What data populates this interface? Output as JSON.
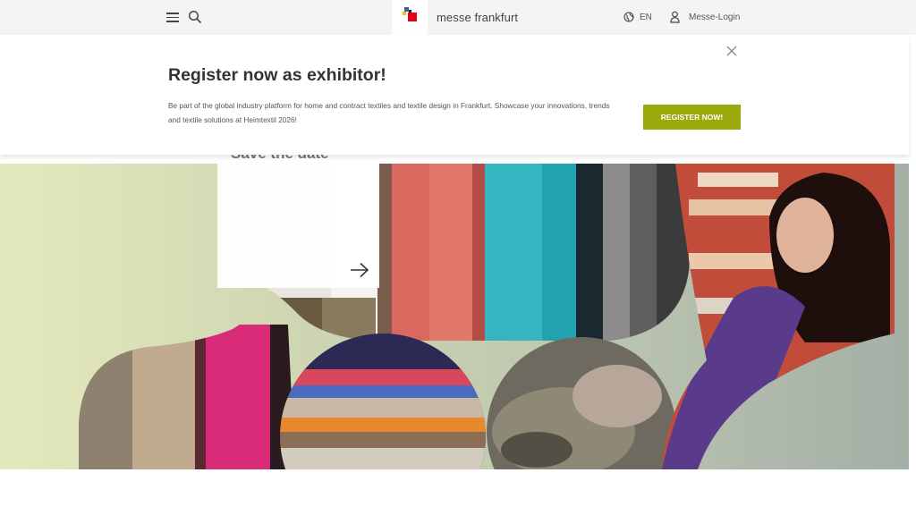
{
  "header": {
    "brand": "messe frankfurt",
    "language": "EN",
    "login_label": "Messe-Login"
  },
  "banner": {
    "title": "Register now as exhibitor!",
    "text": "Be part of the global industry platform for home and contract textiles and textile design in Frankfurt. Showcase your innovations, trends and textile solutions at Heimtextil 2026!",
    "cta_label": "REGISTER NOW!"
  },
  "hero": {
    "teaser_heading": "Save the date"
  },
  "colors": {
    "accent": "#9aa90b",
    "header_bg": "#f4f4f4",
    "logo_red": "#e2001a",
    "logo_blue": "#3a5fa8",
    "logo_yellow": "#f4c400"
  },
  "icons": {
    "menu": "menu-icon",
    "search": "search-icon",
    "globe": "globe-icon",
    "user": "user-icon",
    "close": "close-icon",
    "arrow": "arrow-right-icon"
  }
}
